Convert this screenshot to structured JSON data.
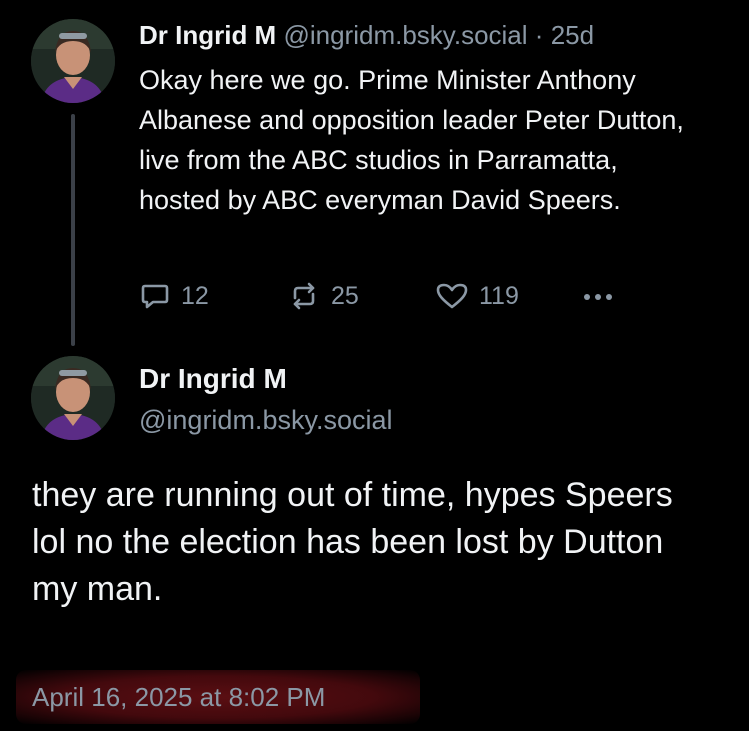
{
  "parent_post": {
    "author_name": "Dr Ingrid M",
    "handle": "@ingridm.bsky.social",
    "separator": "·",
    "age": "25d",
    "text": "Okay here we go. Prime Minister Anthony Albanese and opposition leader Peter Dutton, live from the ABC studios in Parramatta, hosted by ABC everyman David Speers.",
    "actions": {
      "reply_icon": "speech-bubble-icon",
      "reply_count": "12",
      "repost_icon": "repost-arrows-icon",
      "repost_count": "25",
      "like_icon": "heart-icon",
      "like_count": "119",
      "more_icon": "ellipsis-icon"
    }
  },
  "reply_post": {
    "author_name": "Dr Ingrid M",
    "handle": "@ingridm.bsky.social",
    "text": "they are running out of time, hypes Speers lol no the election has been lost by Dutton my man.",
    "timestamp": "April 16, 2025 at 8:02 PM"
  },
  "colors": {
    "background": "#000000",
    "primary_text": "#f1f3f5",
    "secondary_text": "#8b98a5",
    "thread_line": "#3b4048",
    "timestamp_highlight": "#5a0e12"
  }
}
